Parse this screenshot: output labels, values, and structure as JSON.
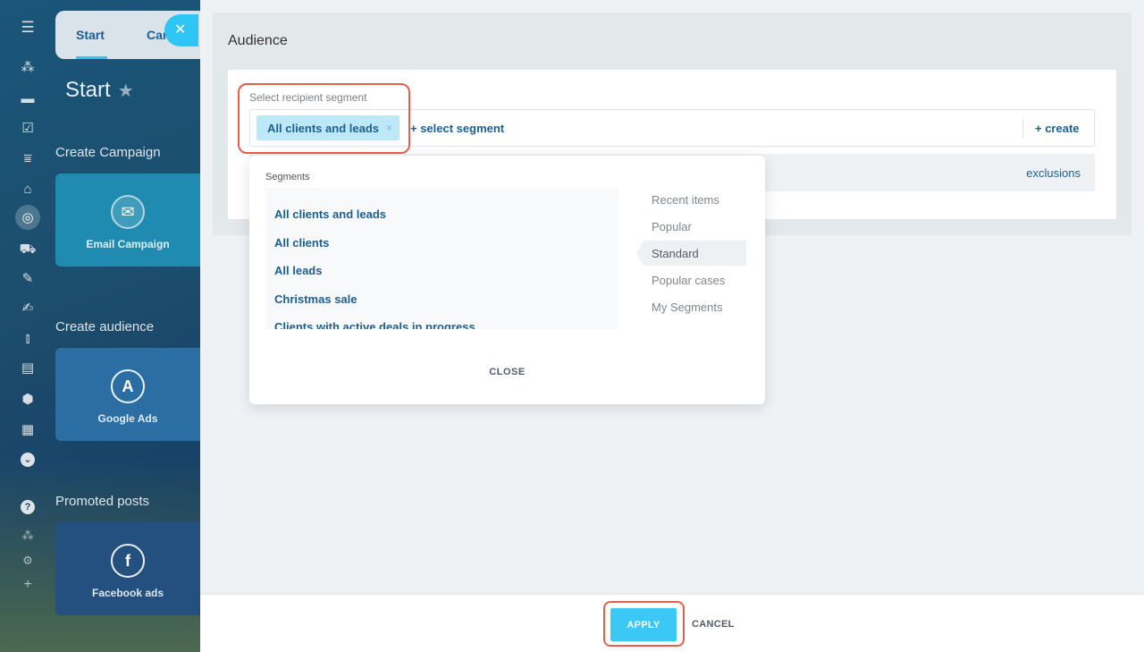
{
  "rail": {
    "menu_icon": "☰",
    "items": [
      {
        "name": "team-icon",
        "glyph": "⁂"
      },
      {
        "name": "robot-icon",
        "glyph": "▬"
      },
      {
        "name": "tasks-icon",
        "glyph": "☑"
      },
      {
        "name": "filter-icon",
        "glyph": "⩸"
      },
      {
        "name": "bank-icon",
        "glyph": "⌂"
      },
      {
        "name": "marketing-target-icon",
        "glyph": "◎"
      },
      {
        "name": "cart-icon",
        "glyph": "⛟"
      },
      {
        "name": "edit-document-icon",
        "glyph": "✎"
      },
      {
        "name": "signature-icon",
        "glyph": "✍"
      },
      {
        "name": "analytics-icon",
        "glyph": "⫾"
      },
      {
        "name": "contact-card-icon",
        "glyph": "▤"
      },
      {
        "name": "box-icon",
        "glyph": "⬢"
      },
      {
        "name": "clipboard-icon",
        "glyph": "▦"
      },
      {
        "name": "more-icon",
        "glyph": "⌄"
      },
      {
        "name": "help-icon",
        "glyph": "?"
      },
      {
        "name": "sitemap-icon",
        "glyph": "⁂"
      },
      {
        "name": "settings-icon",
        "glyph": "⚙"
      },
      {
        "name": "add-icon",
        "glyph": "+"
      }
    ]
  },
  "start_panel": {
    "tab_start": "Start",
    "tab_campaign": "Campaigns",
    "close_glyph": "✕",
    "title": "Start",
    "star_glyph": "★",
    "sections": [
      {
        "title": "Create Campaign",
        "tile_label": "Email Campaign",
        "tile_glyph": "✉"
      },
      {
        "title": "Create audience",
        "tile_label": "Google Ads",
        "tile_glyph": "A"
      },
      {
        "title": "Promoted posts",
        "tile_label": "Facebook ads",
        "tile_glyph": "f"
      }
    ]
  },
  "audience": {
    "title": "Audience",
    "segment_label": "Select recipient segment",
    "selected_chip": "All clients and leads",
    "chip_remove": "×",
    "select_segment": "+ select segment",
    "create": "+ create",
    "exclusions": "exclusions"
  },
  "popup": {
    "header": "Segments",
    "items": [
      "All clients and leads",
      "All clients",
      "All leads",
      "Christmas sale",
      "Clients with active deals in progress"
    ],
    "categories": [
      "Recent items",
      "Popular",
      "Standard",
      "Popular cases",
      "My Segments"
    ],
    "active_category": "Standard",
    "close": "CLOSE"
  },
  "footer": {
    "apply": "APPLY",
    "cancel": "CANCEL"
  },
  "colors": {
    "accent": "#2fc6f6",
    "link": "#1d5e93",
    "highlight": "#e5604b"
  }
}
